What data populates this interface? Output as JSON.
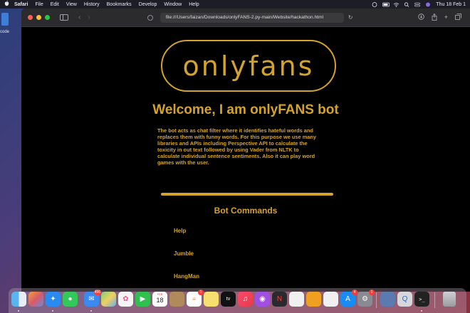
{
  "menubar": {
    "app": "Safari",
    "items": [
      "File",
      "Edit",
      "View",
      "History",
      "Bookmarks",
      "Develop",
      "Window",
      "Help"
    ],
    "clock": "Thu 18 Feb 1"
  },
  "desktop": {
    "label": "code"
  },
  "browser": {
    "url": "file:///Users/faizan/Downloads/onlyFANS-2.py-main/Website/hackathon.html"
  },
  "page": {
    "logo_text": "onlyfans",
    "welcome": "Welcome, I am onlyFANS bot",
    "description": "The bot acts as chat filter where it identifies hateful words and replaces them with funny words. For this purpose we use many libraries and APIs including Perspective API to calculate the toxicity in out text followed by using Vader from NLTK to calculate individual sentence sentiments. Also it can play word games with the user.",
    "commands_title": "Bot Commands",
    "commands": [
      "Help",
      "Jumble",
      "HangMan"
    ]
  },
  "dock": {
    "mail_badge": "496",
    "calendar_month": "FEB",
    "calendar_day": "18",
    "reminders_badge": "1",
    "appstore_badge": "4",
    "settings_badge": "1",
    "appletv_label": "tv"
  },
  "colors": {
    "accent": "#d4a32b",
    "page_bg": "#000000"
  }
}
